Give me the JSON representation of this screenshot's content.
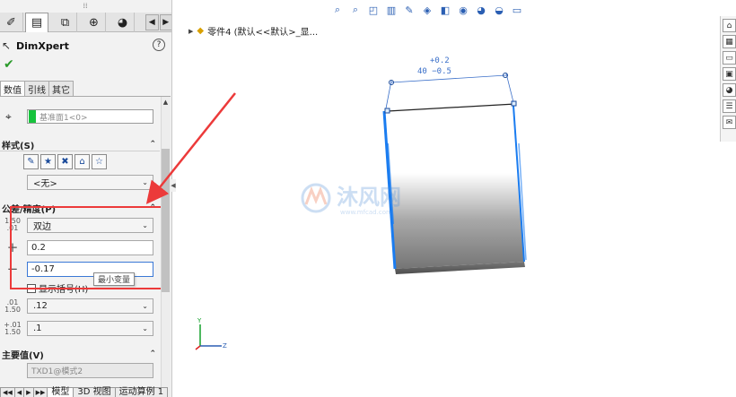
{
  "panel": {
    "tabs": [
      {
        "name": "dimxpert-manager",
        "glyph": "✐"
      },
      {
        "name": "property-manager",
        "glyph": "▤"
      },
      {
        "name": "configuration-manager",
        "glyph": "⧉"
      },
      {
        "name": "target-manager",
        "glyph": "⊕"
      },
      {
        "name": "display-manager",
        "glyph": "◕"
      }
    ],
    "title": "DimXpert",
    "help": "?",
    "subtabs": [
      "数值",
      "引线",
      "其它"
    ],
    "datum": "基准面1<0>",
    "style_section": "样式(S)",
    "style_combo": "<无>",
    "tolerance_section": "公差/精度(P)",
    "tolerance_type": "双边",
    "upper_value": "0.2",
    "lower_value": "-0.17",
    "tooltip": "最小变量",
    "show_parentheses": "显示括号(H)",
    "precision_primary": ".12",
    "precision_tolerance": ".1",
    "primary_value_section": "主要值(V)",
    "primary_value": "TXD1@模式2",
    "bottom_tabs": [
      "模型",
      "3D 视图",
      "运动算例 1"
    ]
  },
  "viewport": {
    "part_breadcrumb": "零件4  (默认<<默认>_显...",
    "dimension_upper": "+0.2",
    "dimension_nominal": "40 −0.5",
    "watermark_title": "沐风网",
    "watermark_url": "www.mfcad.com",
    "triad_y": "Y",
    "triad_z": "Z"
  },
  "colors": {
    "accent": "#3a78d6",
    "datum": "#17c33d",
    "highlight": "#ec3a3a",
    "edge_blue": "#1a7cf0"
  }
}
